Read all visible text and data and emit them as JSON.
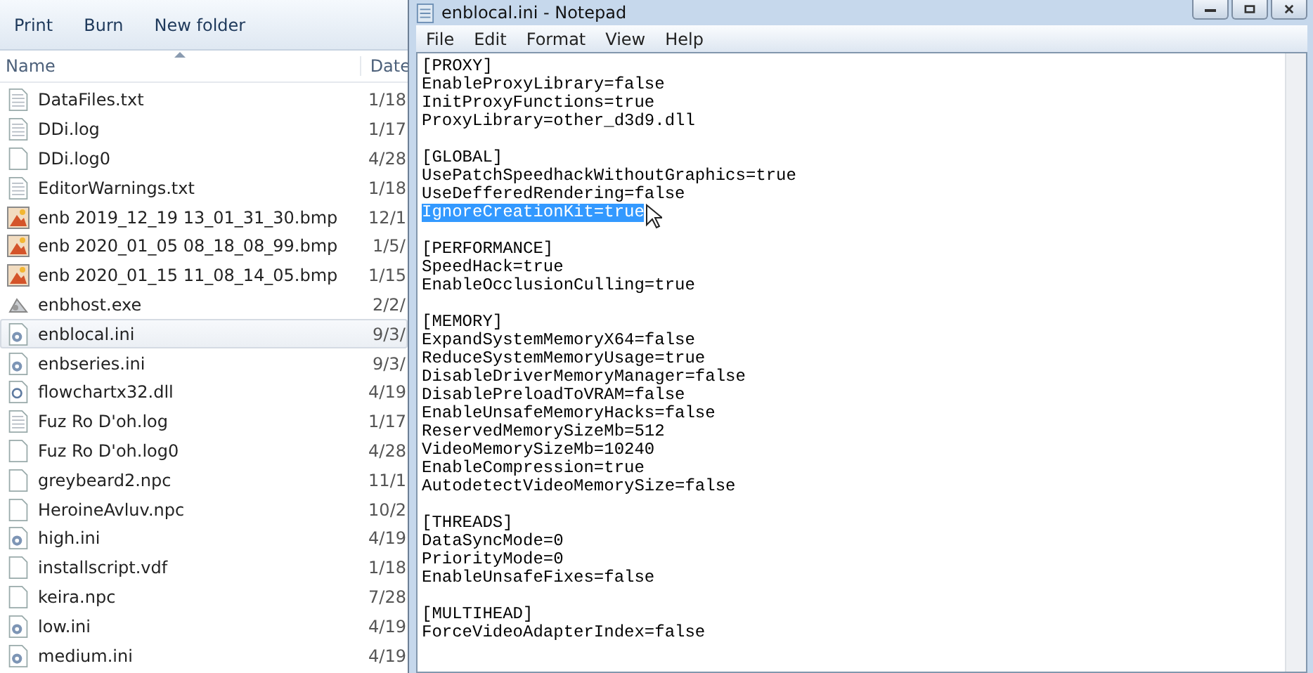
{
  "explorer": {
    "toolbar": [
      "Print",
      "Burn",
      "New folder"
    ],
    "columns": [
      "Name",
      "Date"
    ],
    "files": [
      {
        "name": "DataFiles.txt",
        "date": "1/18",
        "kind": "text",
        "selected": false
      },
      {
        "name": "DDi.log",
        "date": "1/17",
        "kind": "text",
        "selected": false
      },
      {
        "name": "DDi.log0",
        "date": "4/28",
        "kind": "blank",
        "selected": false
      },
      {
        "name": "EditorWarnings.txt",
        "date": "1/18",
        "kind": "text",
        "selected": false
      },
      {
        "name": "enb 2019_12_19 13_01_31_30.bmp",
        "date": "12/1",
        "kind": "image",
        "selected": false
      },
      {
        "name": "enb 2020_01_05 08_18_08_99.bmp",
        "date": "1/5/",
        "kind": "image",
        "selected": false
      },
      {
        "name": "enb 2020_01_15 11_08_14_05.bmp",
        "date": "1/15",
        "kind": "image",
        "selected": false
      },
      {
        "name": "enbhost.exe",
        "date": "2/2/",
        "kind": "exe",
        "selected": false
      },
      {
        "name": "enblocal.ini",
        "date": "9/3/",
        "kind": "ini",
        "selected": true
      },
      {
        "name": "enbseries.ini",
        "date": "9/3/",
        "kind": "ini",
        "selected": false
      },
      {
        "name": "flowchartx32.dll",
        "date": "4/19",
        "kind": "dll",
        "selected": false
      },
      {
        "name": "Fuz Ro D'oh.log",
        "date": "1/17",
        "kind": "text",
        "selected": false
      },
      {
        "name": "Fuz Ro D'oh.log0",
        "date": "4/28",
        "kind": "blank",
        "selected": false
      },
      {
        "name": "greybeard2.npc",
        "date": "11/1",
        "kind": "blank",
        "selected": false
      },
      {
        "name": "HeroineAvluv.npc",
        "date": "10/2",
        "kind": "blank",
        "selected": false
      },
      {
        "name": "high.ini",
        "date": "4/19",
        "kind": "ini",
        "selected": false
      },
      {
        "name": "installscript.vdf",
        "date": "1/18",
        "kind": "blank",
        "selected": false
      },
      {
        "name": "keira.npc",
        "date": "7/28",
        "kind": "blank",
        "selected": false
      },
      {
        "name": "low.ini",
        "date": "4/19",
        "kind": "ini",
        "selected": false
      },
      {
        "name": "medium.ini",
        "date": "4/19",
        "kind": "ini",
        "selected": false
      }
    ]
  },
  "notepad": {
    "title": "enblocal.ini - Notepad",
    "menu": [
      "File",
      "Edit",
      "Format",
      "View",
      "Help"
    ],
    "sections": [
      {
        "header": "[PROXY]",
        "lines": [
          {
            "text": "EnableProxyLibrary=false",
            "selected": false
          },
          {
            "text": "InitProxyFunctions=true",
            "selected": false
          },
          {
            "text": "ProxyLibrary=other_d3d9.dll",
            "selected": false
          }
        ]
      },
      {
        "header": "[GLOBAL]",
        "lines": [
          {
            "text": "UsePatchSpeedhackWithoutGraphics=true",
            "selected": false
          },
          {
            "text": "UseDefferedRendering=false",
            "selected": false
          },
          {
            "text": "IgnoreCreationKit=true",
            "selected": true
          }
        ]
      },
      {
        "header": "[PERFORMANCE]",
        "lines": [
          {
            "text": "SpeedHack=true",
            "selected": false
          },
          {
            "text": "EnableOcclusionCulling=true",
            "selected": false
          }
        ]
      },
      {
        "header": "[MEMORY]",
        "lines": [
          {
            "text": "ExpandSystemMemoryX64=false",
            "selected": false
          },
          {
            "text": "ReduceSystemMemoryUsage=true",
            "selected": false
          },
          {
            "text": "DisableDriverMemoryManager=false",
            "selected": false
          },
          {
            "text": "DisablePreloadToVRAM=false",
            "selected": false
          },
          {
            "text": "EnableUnsafeMemoryHacks=false",
            "selected": false
          },
          {
            "text": "ReservedMemorySizeMb=512",
            "selected": false
          },
          {
            "text": "VideoMemorySizeMb=10240",
            "selected": false
          },
          {
            "text": "EnableCompression=true",
            "selected": false
          },
          {
            "text": "AutodetectVideoMemorySize=false",
            "selected": false
          }
        ]
      },
      {
        "header": "[THREADS]",
        "lines": [
          {
            "text": "DataSyncMode=0",
            "selected": false
          },
          {
            "text": "PriorityMode=0",
            "selected": false
          },
          {
            "text": "EnableUnsafeFixes=false",
            "selected": false
          }
        ]
      },
      {
        "header": "[MULTIHEAD]",
        "lines": [
          {
            "text": "ForceVideoAdapterIndex=false",
            "selected": false
          }
        ]
      }
    ]
  }
}
